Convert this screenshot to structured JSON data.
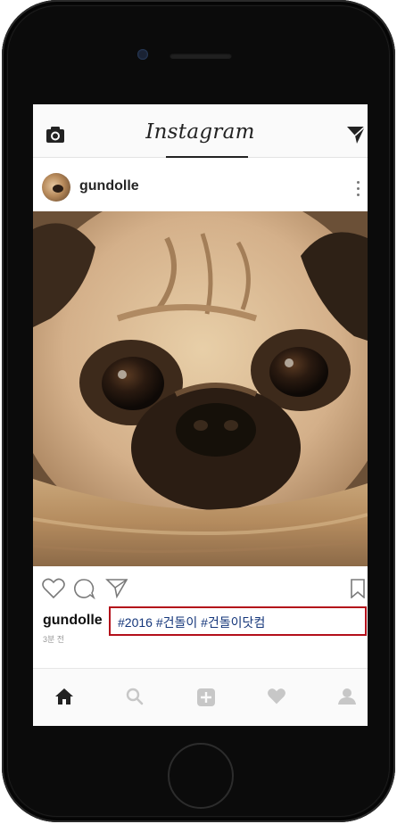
{
  "app": {
    "title": "Instagram"
  },
  "post": {
    "username": "gundolle",
    "caption_username": "gundolle",
    "hashtags": "#2016 #건돌이 #건돌이닷컴",
    "time_ago": "3분 전"
  },
  "icons": {
    "top_left": "camera-icon",
    "top_right": "direct-message-icon",
    "post_menu": "more-options-icon",
    "actions": [
      "heart-icon",
      "comment-icon",
      "share-icon",
      "bookmark-icon"
    ],
    "tabs": [
      "home-icon",
      "search-icon",
      "add-post-icon",
      "activity-heart-icon",
      "profile-icon"
    ]
  },
  "colors": {
    "highlight_border": "#b30f1a",
    "hashtag_text": "#14367a",
    "phone_body": "#0b0b0b"
  }
}
